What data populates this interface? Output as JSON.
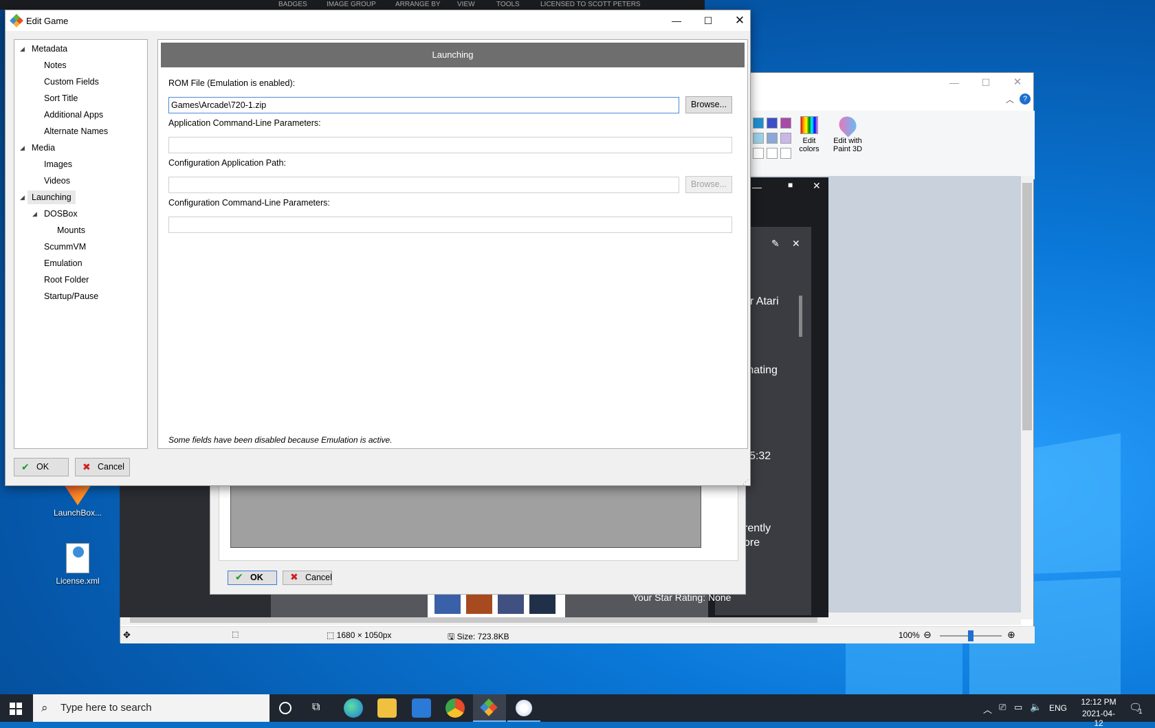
{
  "desktop": {
    "icons": [
      {
        "label": "LaunchBox...",
        "icon": "launchbox-icon"
      },
      {
        "label": "License.xml",
        "icon": "xml-file-icon"
      }
    ]
  },
  "paint": {
    "ribbon": {
      "edit_colors": "Edit\ncolors",
      "edit_paint3d": "Edit with\nPaint 3D"
    },
    "status": {
      "dimensions": "1680 × 1050px",
      "size": "Size: 723.8KB",
      "zoom": "100%"
    }
  },
  "launchbox_bg": {
    "menu": [
      "BADGES",
      "IMAGE GROUP",
      "ARRANGE BY",
      "VIEW",
      "TOOLS",
      "LICENSED TO SCOTT PETERS"
    ],
    "side_texts": [
      "er Atari",
      "rnating",
      "5:32",
      "rently",
      "ore"
    ],
    "star_rating": "Your Star Rating: None"
  },
  "back_dialog": {
    "ok": "OK",
    "cancel": "Cancel"
  },
  "dialog": {
    "title": "Edit Game",
    "tree": [
      {
        "label": "Metadata",
        "level": 0,
        "expand": true
      },
      {
        "label": "Notes",
        "level": 1
      },
      {
        "label": "Custom Fields",
        "level": 1
      },
      {
        "label": "Sort Title",
        "level": 1
      },
      {
        "label": "Additional Apps",
        "level": 1
      },
      {
        "label": "Alternate Names",
        "level": 1
      },
      {
        "label": "Media",
        "level": 0,
        "expand": true
      },
      {
        "label": "Images",
        "level": 1
      },
      {
        "label": "Videos",
        "level": 1
      },
      {
        "label": "Launching",
        "level": 0,
        "expand": true,
        "selected": true
      },
      {
        "label": "DOSBox",
        "level": 1,
        "expand": true
      },
      {
        "label": "Mounts",
        "level": 2
      },
      {
        "label": "ScummVM",
        "level": 1
      },
      {
        "label": "Emulation",
        "level": 1
      },
      {
        "label": "Root Folder",
        "level": 1
      },
      {
        "label": "Startup/Pause",
        "level": 1
      }
    ],
    "panel_title": "Launching",
    "rom_label": "ROM File (Emulation is enabled):",
    "rom_value": "Games\\Arcade\\720-1.zip",
    "browse": "Browse...",
    "app_params_label": "Application Command-Line Parameters:",
    "app_params_value": "",
    "config_path_label": "Configuration Application Path:",
    "config_path_value": "",
    "config_params_label": "Configuration Command-Line Parameters:",
    "config_params_value": "",
    "note": "Some fields have been disabled because Emulation is active.",
    "ok": "OK",
    "cancel": "Cancel"
  },
  "taskbar": {
    "search_placeholder": "Type here to search",
    "lang": "ENG",
    "time": "12:12 PM",
    "date": "2021-04-12",
    "notifications": "1"
  }
}
